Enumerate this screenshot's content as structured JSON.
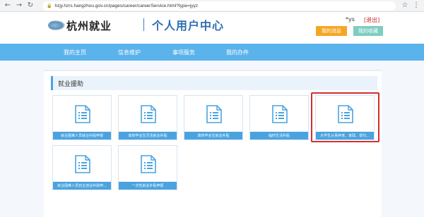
{
  "browser": {
    "back_icon": "arrow-left-icon",
    "forward_icon": "arrow-right-icon",
    "reload_icon": "reload-icon",
    "url": "hzjy.hzrs.hangzhou.gov.cn/pages/career/careerService.html?type=jyyz"
  },
  "header": {
    "logo_text": "杭州就业",
    "page_title": "个人用户中心",
    "user_name": "*ys",
    "logout": "[退出]",
    "my_messages": "我的消息",
    "my_favorites": "我的收藏"
  },
  "nav": {
    "items": [
      "我的主页",
      "信息维护",
      "事项服务",
      "我的办件"
    ]
  },
  "section": {
    "title": "就业援助"
  },
  "cards": [
    {
      "label": "就业困难人员就业补贴申报"
    },
    {
      "label": "高校毕业生灵活就业补贴"
    },
    {
      "label": "高校毕业生就业补贴"
    },
    {
      "label": "临时生活补贴"
    },
    {
      "label": "大学生从事养老、家政、现代..."
    },
    {
      "label": "就业困难人员自主创业补助申..."
    },
    {
      "label": "一次性就业补贴申报"
    }
  ],
  "colors": {
    "nav_bg": "#5bb3ec",
    "card_label_bg": "#4aa3df",
    "title_blue": "#2c6fb0",
    "messages_btn": "#f5a623",
    "favorites_btn": "#7ecdc0",
    "highlight": "#d32f2f"
  }
}
